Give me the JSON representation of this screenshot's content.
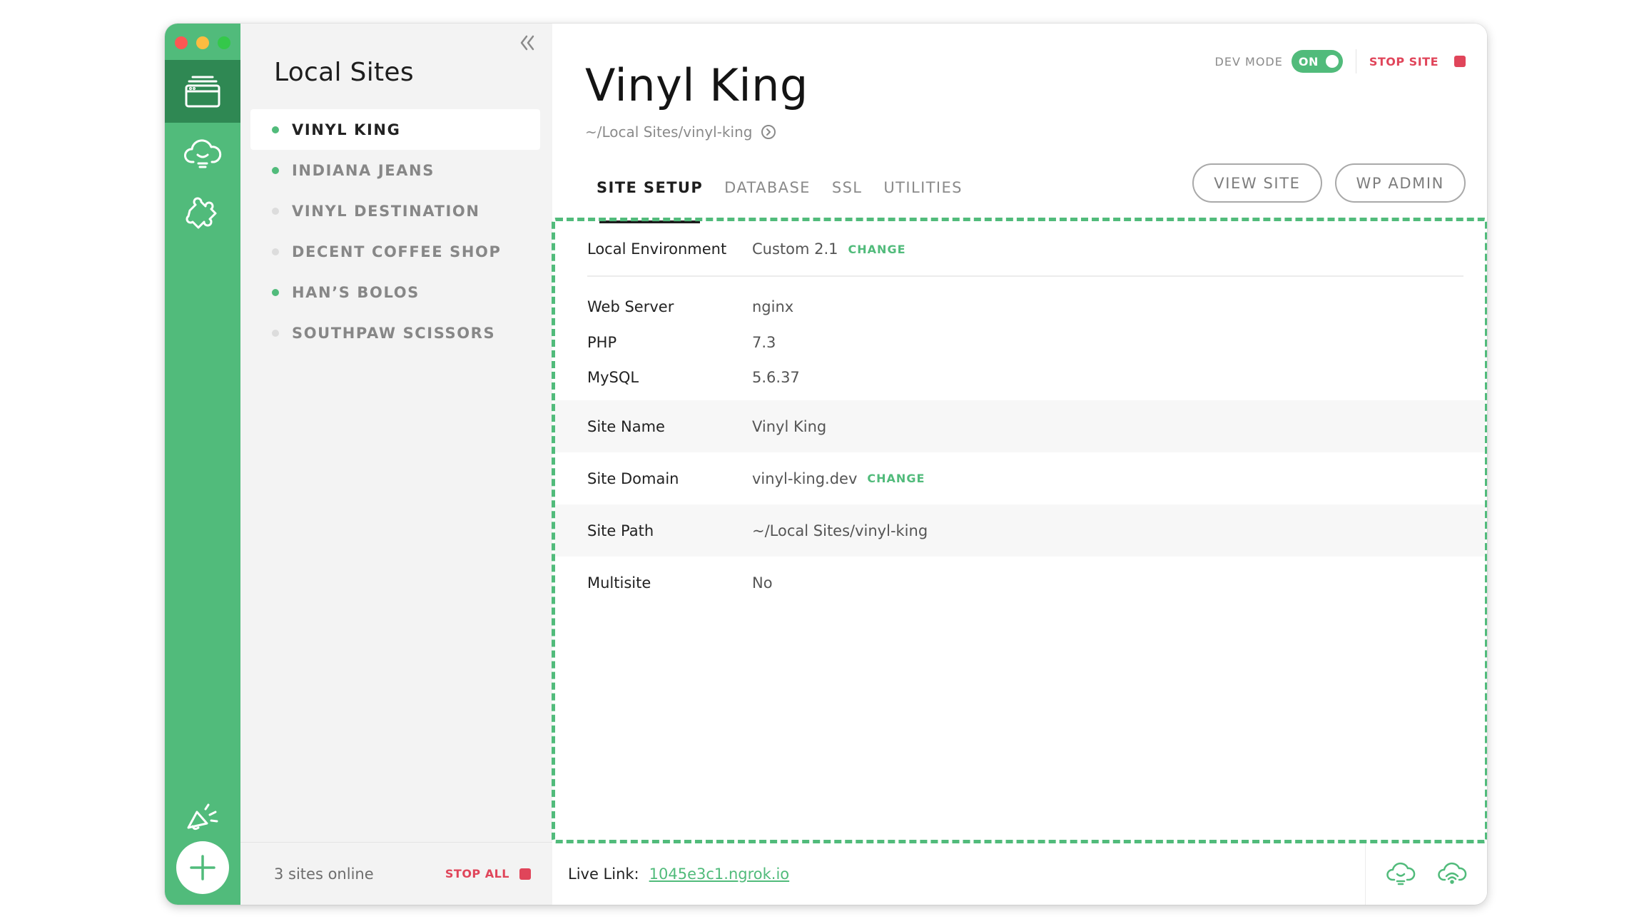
{
  "sidebar": {
    "title": "Local Sites",
    "sites": [
      {
        "name": "VINYL KING",
        "online": true
      },
      {
        "name": "INDIANA JEANS",
        "online": true
      },
      {
        "name": "VINYL DESTINATION",
        "online": false
      },
      {
        "name": "DECENT COFFEE SHOP",
        "online": false
      },
      {
        "name": "HAN’S BOLOS",
        "online": true
      },
      {
        "name": "SOUTHPAW SCISSORS",
        "online": false
      }
    ],
    "online_count": "3 sites online",
    "stop_all_label": "STOP ALL"
  },
  "header": {
    "title": "Vinyl King",
    "path": "~/Local Sites/vinyl-king",
    "dev_mode_label": "DEV MODE",
    "dev_mode_state": "ON",
    "stop_site_label": "STOP SITE"
  },
  "tabs": [
    "SITE SETUP",
    "DATABASE",
    "SSL",
    "UTILITIES"
  ],
  "actions": {
    "view_site": "VIEW SITE",
    "wp_admin": "WP ADMIN"
  },
  "setup": {
    "environment_label": "Local Environment",
    "environment_value": "Custom 2.1",
    "change_label": "CHANGE",
    "web_server_label": "Web Server",
    "web_server_value": "nginx",
    "php_label": "PHP",
    "php_value": "7.3",
    "mysql_label": "MySQL",
    "mysql_value": "5.6.37",
    "site_name_label": "Site Name",
    "site_name_value": "Vinyl King",
    "site_domain_label": "Site Domain",
    "site_domain_value": "vinyl-king.dev",
    "site_path_label": "Site Path",
    "site_path_value": "~/Local Sites/vinyl-king",
    "multisite_label": "Multisite",
    "multisite_value": "No"
  },
  "footer": {
    "live_link_label": "Live Link:",
    "live_link_url": "1045e3c1.ngrok.io"
  },
  "colors": {
    "accent": "#51bb7b",
    "accent_dark": "#2f8853",
    "stop": "#e0455a"
  },
  "icons": {
    "rail": [
      "sites-icon",
      "cloud-icon",
      "addons-puzzle-icon",
      "news-megaphone-icon",
      "add-plus-icon"
    ],
    "footer": [
      "cloud-download-icon",
      "cloud-share-icon"
    ]
  }
}
